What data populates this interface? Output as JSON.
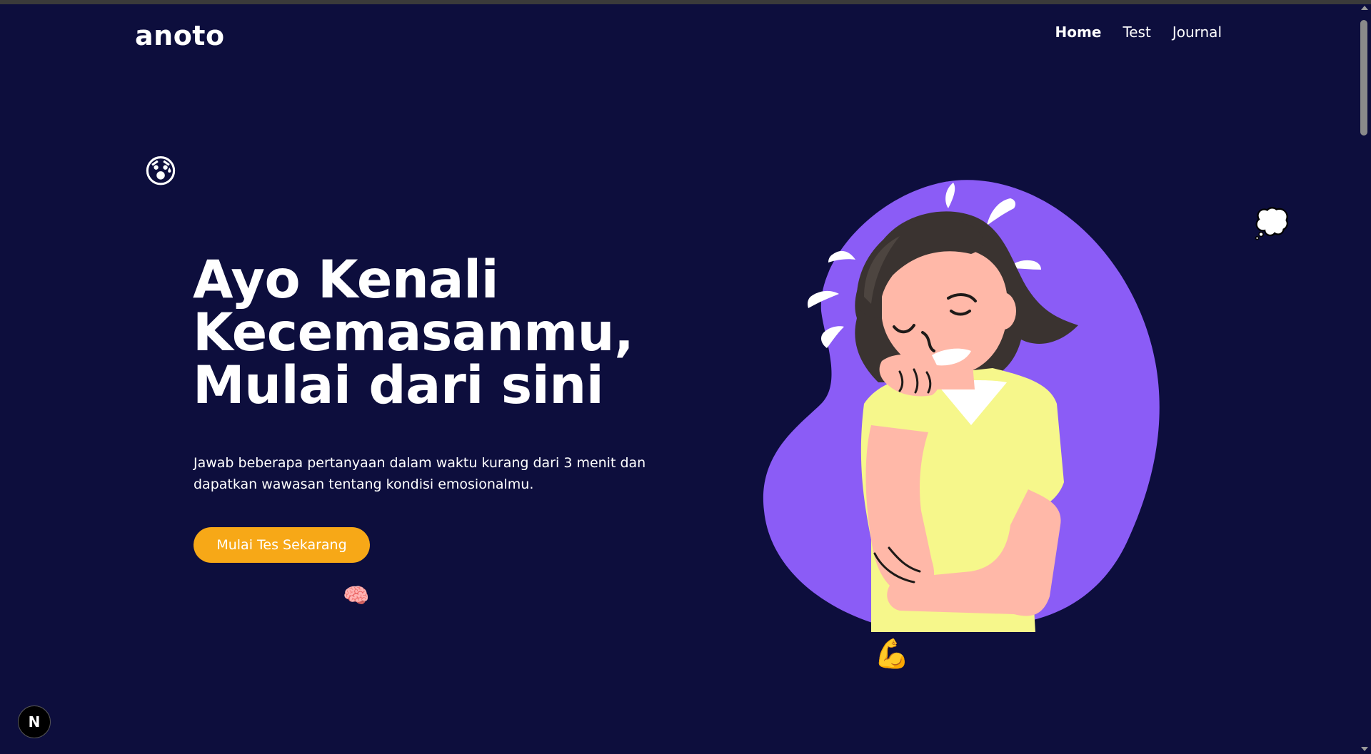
{
  "app": {
    "logo": "anoto"
  },
  "nav": {
    "items": [
      {
        "label": "Home",
        "active": true
      },
      {
        "label": "Test",
        "active": false
      },
      {
        "label": "Journal",
        "active": false
      }
    ]
  },
  "hero": {
    "title_lines": [
      "Ayo Kenali",
      "Kecemasanmu,",
      "Mulai dari sini"
    ],
    "description": "Jawab beberapa pertanyaan dalam waktu kurang dari 3 menit dan dapatkan wawasan tentang kondisi emosionalmu.",
    "cta_label": "Mulai Tes Sekarang"
  },
  "decorations": {
    "anxious_emoji": "😰",
    "brain_emoji": "🧠",
    "thought_emoji": "💭",
    "muscle_emoji": "💪"
  },
  "dev_badge": {
    "label": "N"
  },
  "colors": {
    "background": "#0d0e3d",
    "accent": "#f7a817",
    "blob": "#8b5cf6",
    "shirt": "#f6f78b",
    "skin": "#ffb8a8",
    "hair": "#3a3330"
  }
}
